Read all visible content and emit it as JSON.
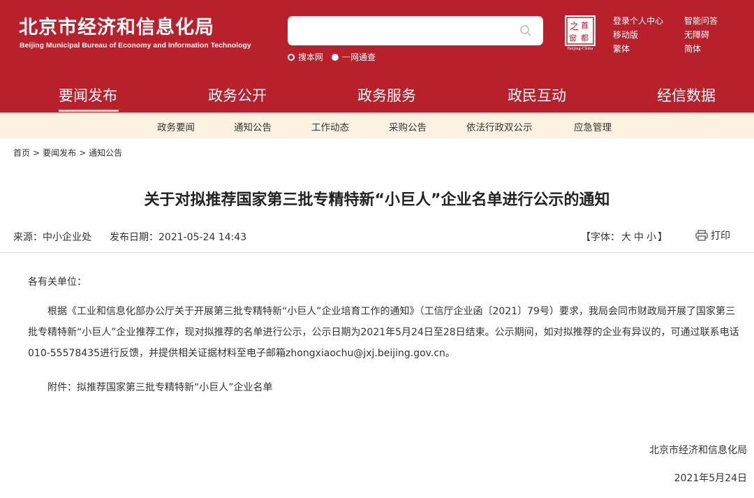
{
  "header": {
    "logo_cn": "北京市经济和信息化局",
    "logo_en": "Beijing Municipal Bureau of Economy and Information Technology",
    "search": {
      "placeholder": ""
    },
    "search_scope": [
      {
        "label": "搜本网",
        "selected": false
      },
      {
        "label": "一网通查",
        "selected": true
      }
    ],
    "seal_caption": "Beijing-China",
    "top_links_col1": [
      "登录个人中心",
      "移动版",
      "繁体"
    ],
    "top_links_col2": [
      "智能问答",
      "无障碍",
      "简体"
    ],
    "colors": {
      "brand": "#b8202b",
      "subnav_bg": "#fdf2e2"
    }
  },
  "main_nav": {
    "items": [
      "要闻发布",
      "政务公开",
      "政务服务",
      "政民互动",
      "经信数据"
    ],
    "active_index": 0
  },
  "sub_nav": {
    "items": [
      "政务要闻",
      "通知公告",
      "工作动态",
      "采购公告",
      "依法行政双公示",
      "应急管理"
    ]
  },
  "breadcrumb": [
    "首页",
    "要闻发布",
    "通知公告"
  ],
  "article": {
    "title": "关于对拟推荐国家第三批专精特新“小巨人”企业名单进行公示的通知",
    "source_label": "来源：",
    "source": "中小企业处",
    "date_label": "发布日期：",
    "publish_time": "2021-05-24 14:43",
    "font_label_open": "【字体：",
    "font_sizes": [
      "大",
      "中",
      "小"
    ],
    "font_label_close": "】",
    "print_label": "打印",
    "salutation": "各有关单位：",
    "body": "根据《工业和信息化部办公厅关于开展第三批专精特新“小巨人”企业培育工作的通知》（工信厅企业函〔2021〕79号）要求，我局会同市财政局开展了国家第三批专精特新“小巨人”企业推荐工作，现对拟推荐的名单进行公示，公示日期为2021年5月24日至28日结束。公示期间，如对拟推荐的企业有异议的，可通过联系电话010-55578435进行反馈，并提供相关证据材料至电子邮箱zhongxiaochu@jxj.beijing.gov.cn。",
    "attachment": "附件：拟推荐国家第三批专精特新“小巨人”企业名单",
    "signature": "北京市经济和信息化局",
    "sign_date": "2021年5月24日"
  }
}
